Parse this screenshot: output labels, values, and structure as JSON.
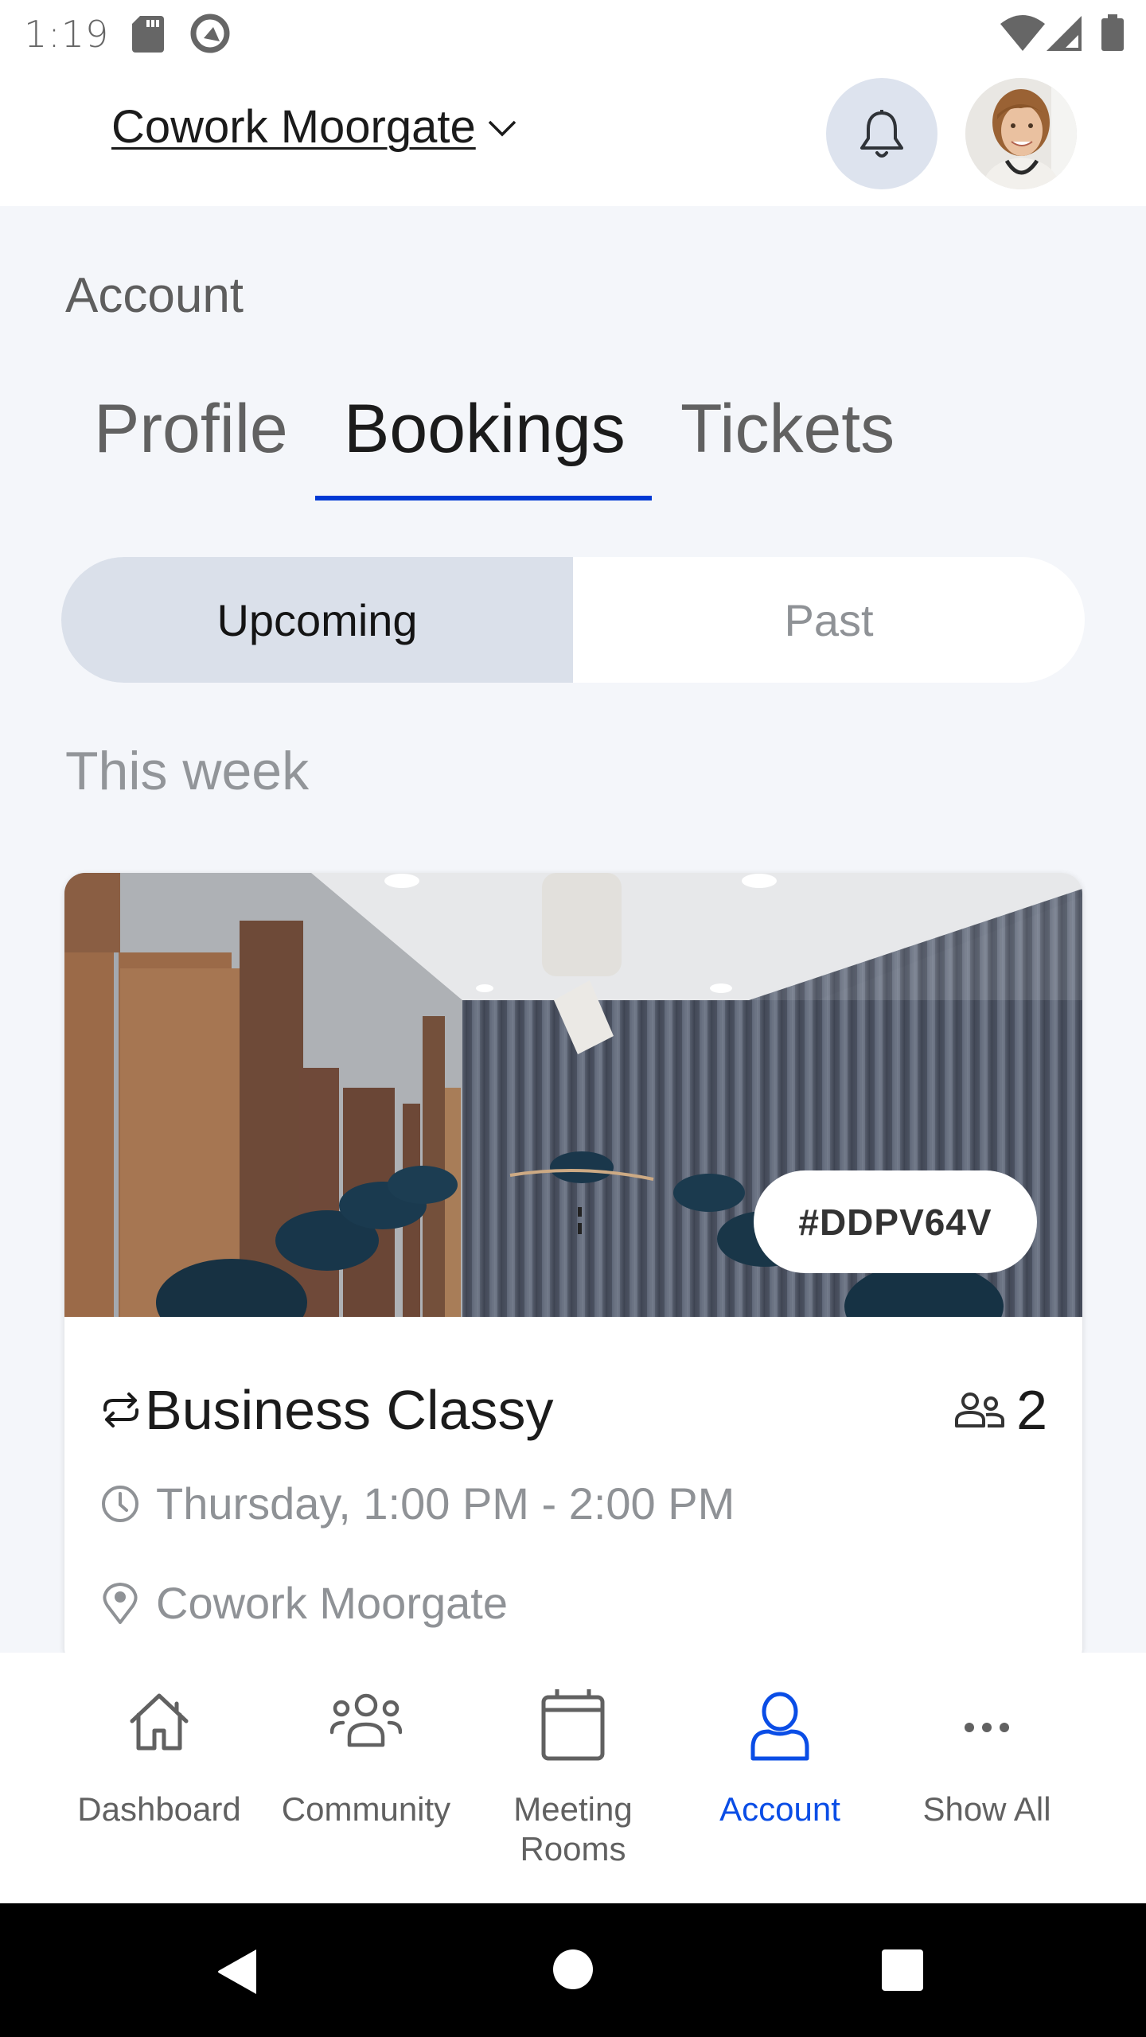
{
  "status_bar": {
    "time": "1:19",
    "left_icons": [
      "sd-card-icon",
      "data-saver-icon"
    ],
    "right_icons": [
      "wifi-icon",
      "cell-signal-icon",
      "battery-icon"
    ]
  },
  "header": {
    "location": "Cowork Moorgate",
    "location_icon": "chevron-down-icon",
    "notifications_icon": "bell-icon",
    "avatar_alt": "User avatar"
  },
  "page": {
    "title": "Account",
    "tabs": [
      {
        "label": "Profile",
        "active": false
      },
      {
        "label": "Bookings",
        "active": true
      },
      {
        "label": "Tickets",
        "active": false
      }
    ],
    "segments": [
      {
        "label": "Upcoming",
        "active": true
      },
      {
        "label": "Past",
        "active": false
      }
    ],
    "section_title": "This week"
  },
  "booking": {
    "reference": "#DDPV64V",
    "title": "Business Classy",
    "recurring": true,
    "capacity": "2",
    "time": "Thursday, 1:00 PM - 2:00 PM",
    "location": "Cowork Moorgate"
  },
  "bottom_nav": {
    "items": [
      {
        "label": "Dashboard",
        "icon": "home-icon",
        "active": false
      },
      {
        "label": "Community",
        "icon": "community-icon",
        "active": false
      },
      {
        "label": "Meeting\nRooms",
        "label_line1": "Meeting",
        "label_line2": "Rooms",
        "icon": "calendar-icon",
        "active": false
      },
      {
        "label": "Account",
        "icon": "user-icon",
        "active": true
      },
      {
        "label": "Show All",
        "icon": "more-icon",
        "active": false
      }
    ]
  },
  "colors": {
    "accent": "#0039d4",
    "nav_active": "#0a4de6",
    "background": "#f4f6fa",
    "segment_active": "#dae0ea",
    "bell_bg": "#dde3ee"
  }
}
